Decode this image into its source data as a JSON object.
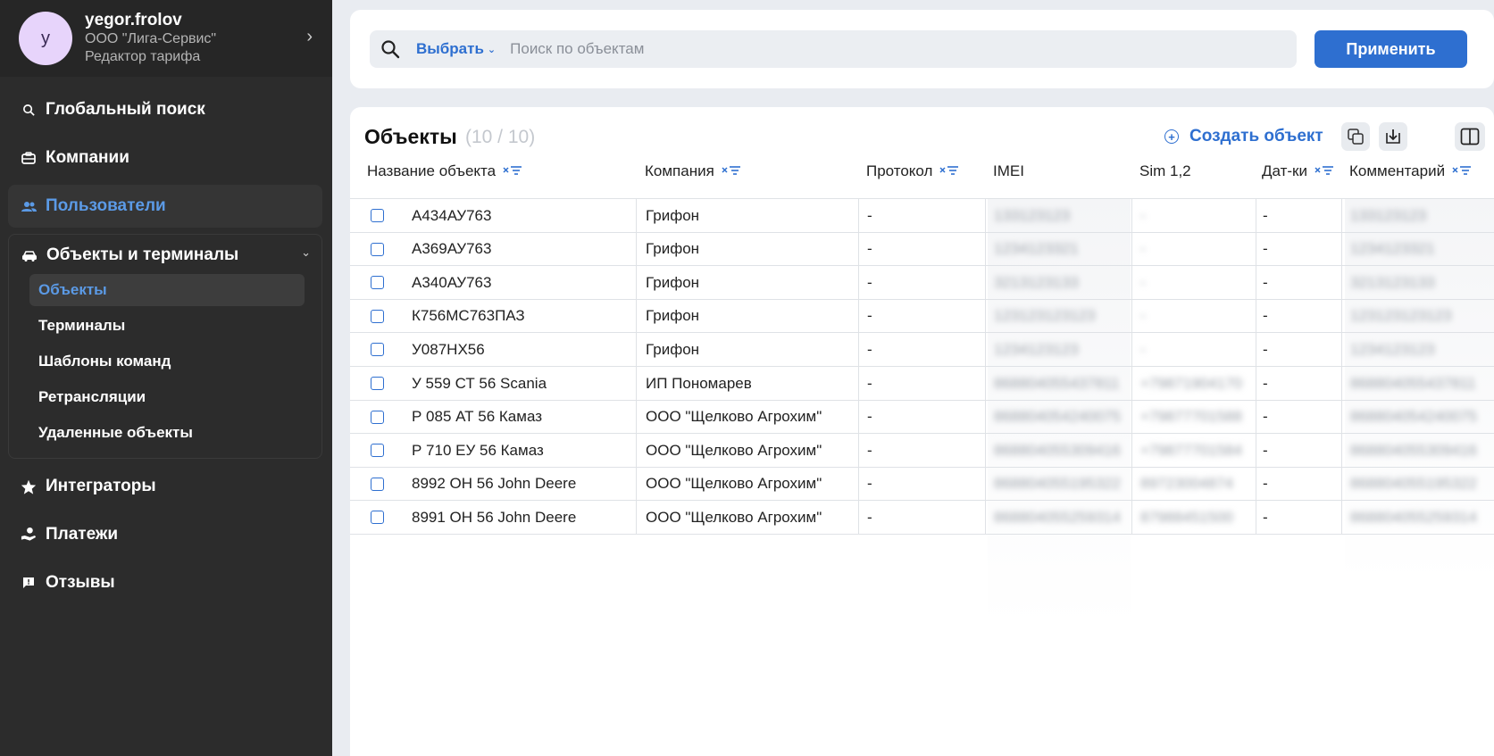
{
  "profile": {
    "avatar_letter": "y",
    "username": "yegor.frolov",
    "company": "ООО \"Лига-Сервис\"",
    "role": "Редактор тарифа"
  },
  "nav": {
    "global_search": "Глобальный поиск",
    "companies": "Компании",
    "users": "Пользователи",
    "objects_group": "Объекты и терминалы",
    "sub": {
      "objects": "Объекты",
      "terminals": "Терминалы",
      "templates": "Шаблоны команд",
      "retranslations": "Ретрансляции",
      "deleted": "Удаленные объекты"
    },
    "integrators": "Интеграторы",
    "payments": "Платежи",
    "reviews": "Отзывы"
  },
  "search": {
    "select_label": "Выбрать",
    "placeholder": "Поиск по объектам",
    "apply_label": "Применить"
  },
  "card": {
    "title": "Объекты",
    "count": "(10 / 10)",
    "create_label": "Создать объект"
  },
  "columns": {
    "name": "Название объекта",
    "company": "Компания",
    "protocol": "Протокол",
    "imei": "IMEI",
    "sim": "Sim 1,2",
    "sensors": "Дат-ки",
    "comment": "Комментарий"
  },
  "rows": [
    {
      "name": "А434АУ763",
      "company": "Грифон",
      "protocol": "-",
      "imei": "133123123",
      "sim": "-",
      "sensors": "-",
      "comment": "133123123"
    },
    {
      "name": "А369АУ763",
      "company": "Грифон",
      "protocol": "-",
      "imei": "1234123321",
      "sim": "-",
      "sensors": "-",
      "comment": "1234123321"
    },
    {
      "name": "А340АУ763",
      "company": "Грифон",
      "protocol": "-",
      "imei": "3213123133",
      "sim": "-",
      "sensors": "-",
      "comment": "3213123133"
    },
    {
      "name": "К756МС763ПАЗ",
      "company": "Грифон",
      "protocol": "-",
      "imei": "123123123123",
      "sim": "-",
      "sensors": "-",
      "comment": "123123123123"
    },
    {
      "name": "У087НХ56",
      "company": "Грифон",
      "protocol": "-",
      "imei": "1234123123",
      "sim": "-",
      "sensors": "-",
      "comment": "1234123123"
    },
    {
      "name": "У 559 СТ 56 Scania",
      "company": "ИП Пономарев",
      "protocol": "-",
      "imei": "868804055437811",
      "sim": "+79871904170",
      "sensors": "-",
      "comment": "868804055437811"
    },
    {
      "name": "Р 085 АТ 56 Камаз",
      "company": "ООО \"Щелково Агрохим\"",
      "protocol": "-",
      "imei": "868804054240075",
      "sim": "+79877701588",
      "sensors": "-",
      "comment": "868804054240075"
    },
    {
      "name": "Р 710 ЕУ 56 Камаз",
      "company": "ООО \"Щелково Агрохим\"",
      "protocol": "-",
      "imei": "868804055309416",
      "sim": "+79877701584",
      "sensors": "-",
      "comment": "868804055309416"
    },
    {
      "name": "8992 ОН 56 John Deere",
      "company": "ООО \"Щелково Агрохим\"",
      "protocol": "-",
      "imei": "868804055195322",
      "sim": "89723004874",
      "sensors": "-",
      "comment": "868804055195322"
    },
    {
      "name": "8991 ОН 56 John Deere",
      "company": "ООО \"Щелково Агрохим\"",
      "protocol": "-",
      "imei": "868804055259314",
      "sim": "87988451500",
      "sensors": "-",
      "comment": "868804055259314"
    }
  ],
  "colors": {
    "accent": "#2e6fd0",
    "sidebar_bg": "#2c2c2c",
    "active_text": "#5b9ae6",
    "page_bg": "#e9ecf1"
  }
}
